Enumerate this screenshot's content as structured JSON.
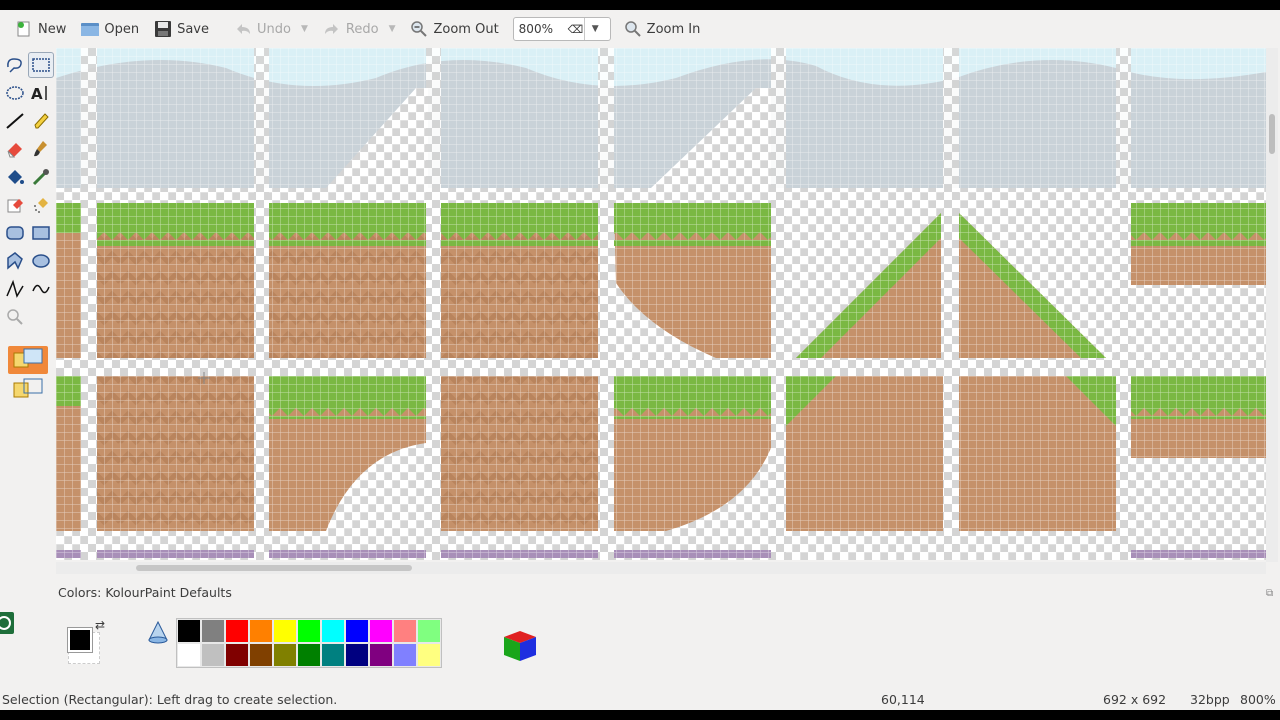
{
  "toolbar": {
    "new_label": "New",
    "open_label": "Open",
    "save_label": "Save",
    "undo_label": "Undo",
    "redo_label": "Redo",
    "zoom_out_label": "Zoom Out",
    "zoom_value": "800%",
    "zoom_in_label": "Zoom In"
  },
  "tools": [
    "free-form-selection",
    "rectangular-selection",
    "elliptical-selection",
    "text",
    "line",
    "pen",
    "eraser",
    "brush",
    "flood-fill",
    "color-picker",
    "color-eraser",
    "spraycan",
    "rounded-rectangle",
    "rectangle",
    "polygon",
    "ellipse",
    "connected-lines",
    "curve",
    "zoom"
  ],
  "colors": {
    "title": "Colors: KolourPaint Defaults",
    "foreground": "#000000",
    "background": "#ffffff",
    "palette_row1": [
      "#000000",
      "#808080",
      "#ff0000",
      "#ff8000",
      "#ffff00",
      "#00ff00",
      "#00ffff",
      "#0000ff",
      "#ff00ff",
      "#ff8080",
      "#80ff80"
    ],
    "palette_row2": [
      "#ffffff",
      "#c0c0c0",
      "#800000",
      "#804000",
      "#808000",
      "#008000",
      "#008080",
      "#000080",
      "#800080",
      "#8080ff",
      "#ffff80"
    ]
  },
  "status": {
    "message": "Selection (Rectangular): Left drag to create selection.",
    "cursor": "60,114",
    "size": "692 x 692",
    "depth": "32bpp",
    "zoom": "800%"
  },
  "theme": {
    "grass": "#7ab843",
    "grass_dark": "#5c9a2c",
    "dirt": "#c5916a",
    "dirt_dark": "#b07a55",
    "sky": "#c9d2d8",
    "sky_light": "#daf0f6",
    "purple": "#a88fb8"
  }
}
